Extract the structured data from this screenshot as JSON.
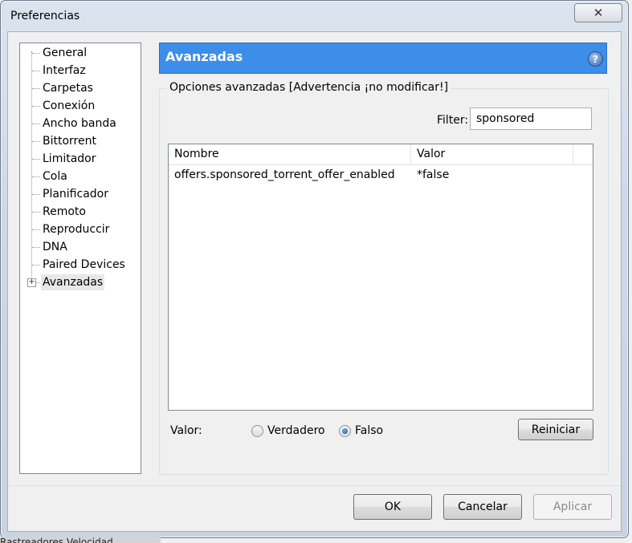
{
  "window": {
    "title": "Preferencias",
    "close_glyph": "✕"
  },
  "sidebar": {
    "items": [
      {
        "label": "General"
      },
      {
        "label": "Interfaz"
      },
      {
        "label": "Carpetas"
      },
      {
        "label": "Conexión"
      },
      {
        "label": "Ancho banda"
      },
      {
        "label": "Bittorrent"
      },
      {
        "label": "Limitador"
      },
      {
        "label": "Cola"
      },
      {
        "label": "Planificador"
      },
      {
        "label": "Remoto"
      },
      {
        "label": "Reproduccir"
      },
      {
        "label": "DNA"
      },
      {
        "label": "Paired Devices"
      },
      {
        "label": "Avanzadas"
      }
    ],
    "selected": "Avanzadas",
    "expander_glyph": "+"
  },
  "header": {
    "title": "Avanzadas",
    "help_glyph": "?"
  },
  "group": {
    "legend": "Opciones avanzadas [Advertencia ¡no modificar!]"
  },
  "filter": {
    "label": "Filter:",
    "value": "sponsored"
  },
  "table": {
    "columns": [
      "Nombre",
      "Valor"
    ],
    "rows": [
      {
        "name": "offers.sponsored_torrent_offer_enabled",
        "value": "*false"
      }
    ]
  },
  "value_editor": {
    "label": "Valor:",
    "options": [
      "Verdadero",
      "Falso"
    ],
    "selected": "Falso",
    "reset_label": "Reiniciar"
  },
  "footer": {
    "ok_label": "OK",
    "cancel_label": "Cancelar",
    "apply_label": "Aplicar"
  },
  "background_window": {
    "text": "Rastreadores  Velocidad"
  }
}
